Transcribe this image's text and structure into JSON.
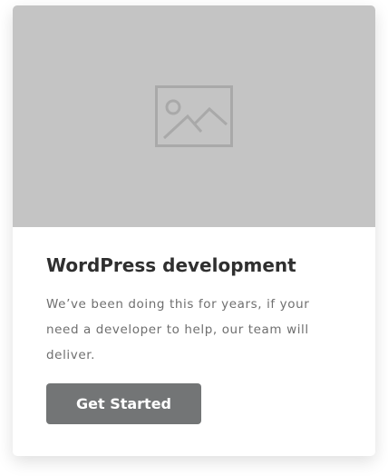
{
  "card": {
    "image_icon": "image-placeholder-icon",
    "title": "WordPress development",
    "description": "We’ve been doing this for years, if your need a developer to help, our team will deliver.",
    "button_label": "Get Started",
    "colors": {
      "image_bg": "#c4c4c4",
      "button_bg": "#737576",
      "title": "#2f2f2f",
      "text": "#6f6f6f"
    }
  }
}
